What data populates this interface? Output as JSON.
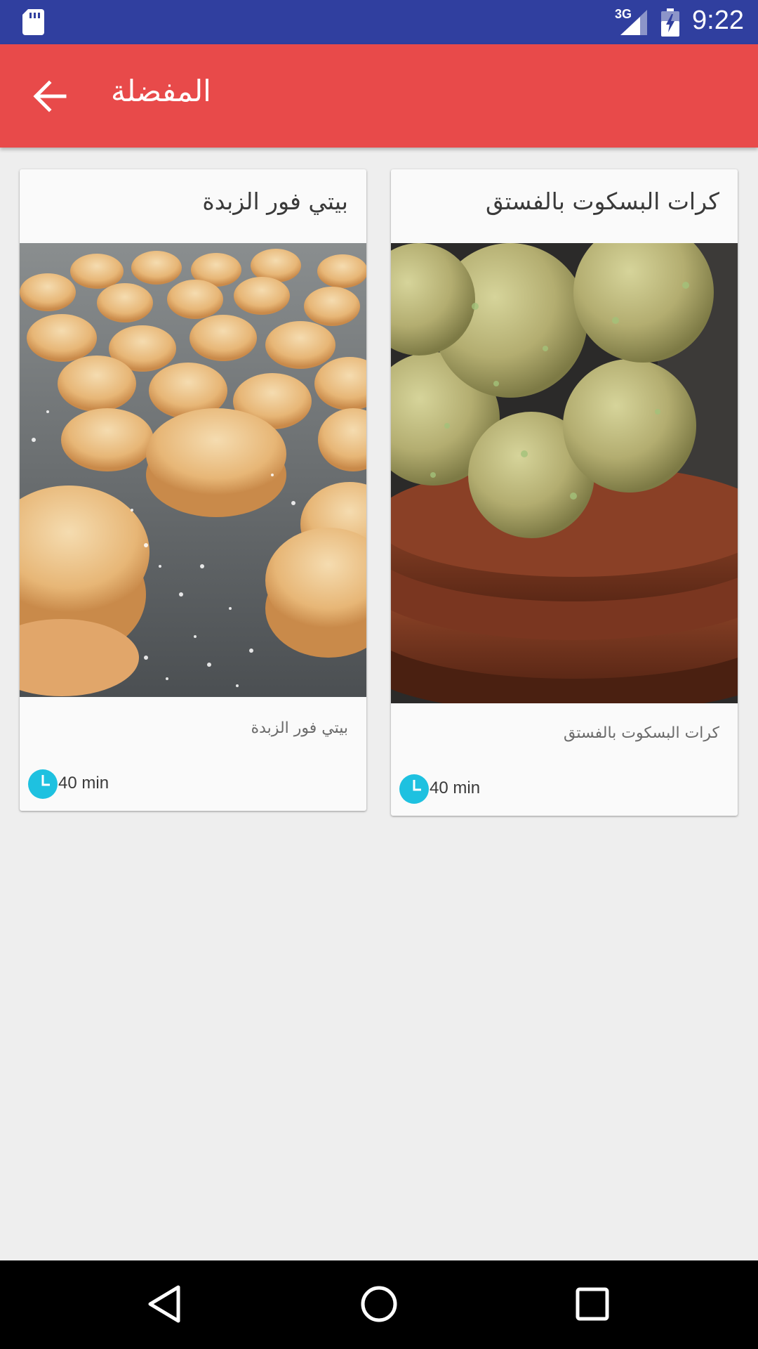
{
  "status_bar": {
    "network_type": "3G",
    "time": "9:22"
  },
  "toolbar": {
    "title": "المفضلة",
    "back_icon": "arrow-back-icon"
  },
  "recipes": [
    {
      "title": "بيتي فور الزبدة",
      "subtitle": "بيتي فور الزبدة",
      "time": "40 min",
      "image": "sandwich-cookies-photo"
    },
    {
      "title": "كرات البسكوت بالفستق",
      "subtitle": "كرات البسكوت بالفستق",
      "time": "40 min",
      "image": "pistachio-balls-photo"
    }
  ],
  "colors": {
    "status_bar": "#303f9f",
    "toolbar": "#e84a4a",
    "background": "#eeeeee",
    "card": "#fafafa",
    "clock_icon": "#1ec1e0",
    "nav_bar": "#000000"
  },
  "nav_bar": {
    "back_icon": "nav-back-icon",
    "home_icon": "nav-home-icon",
    "recents_icon": "nav-recents-icon"
  }
}
